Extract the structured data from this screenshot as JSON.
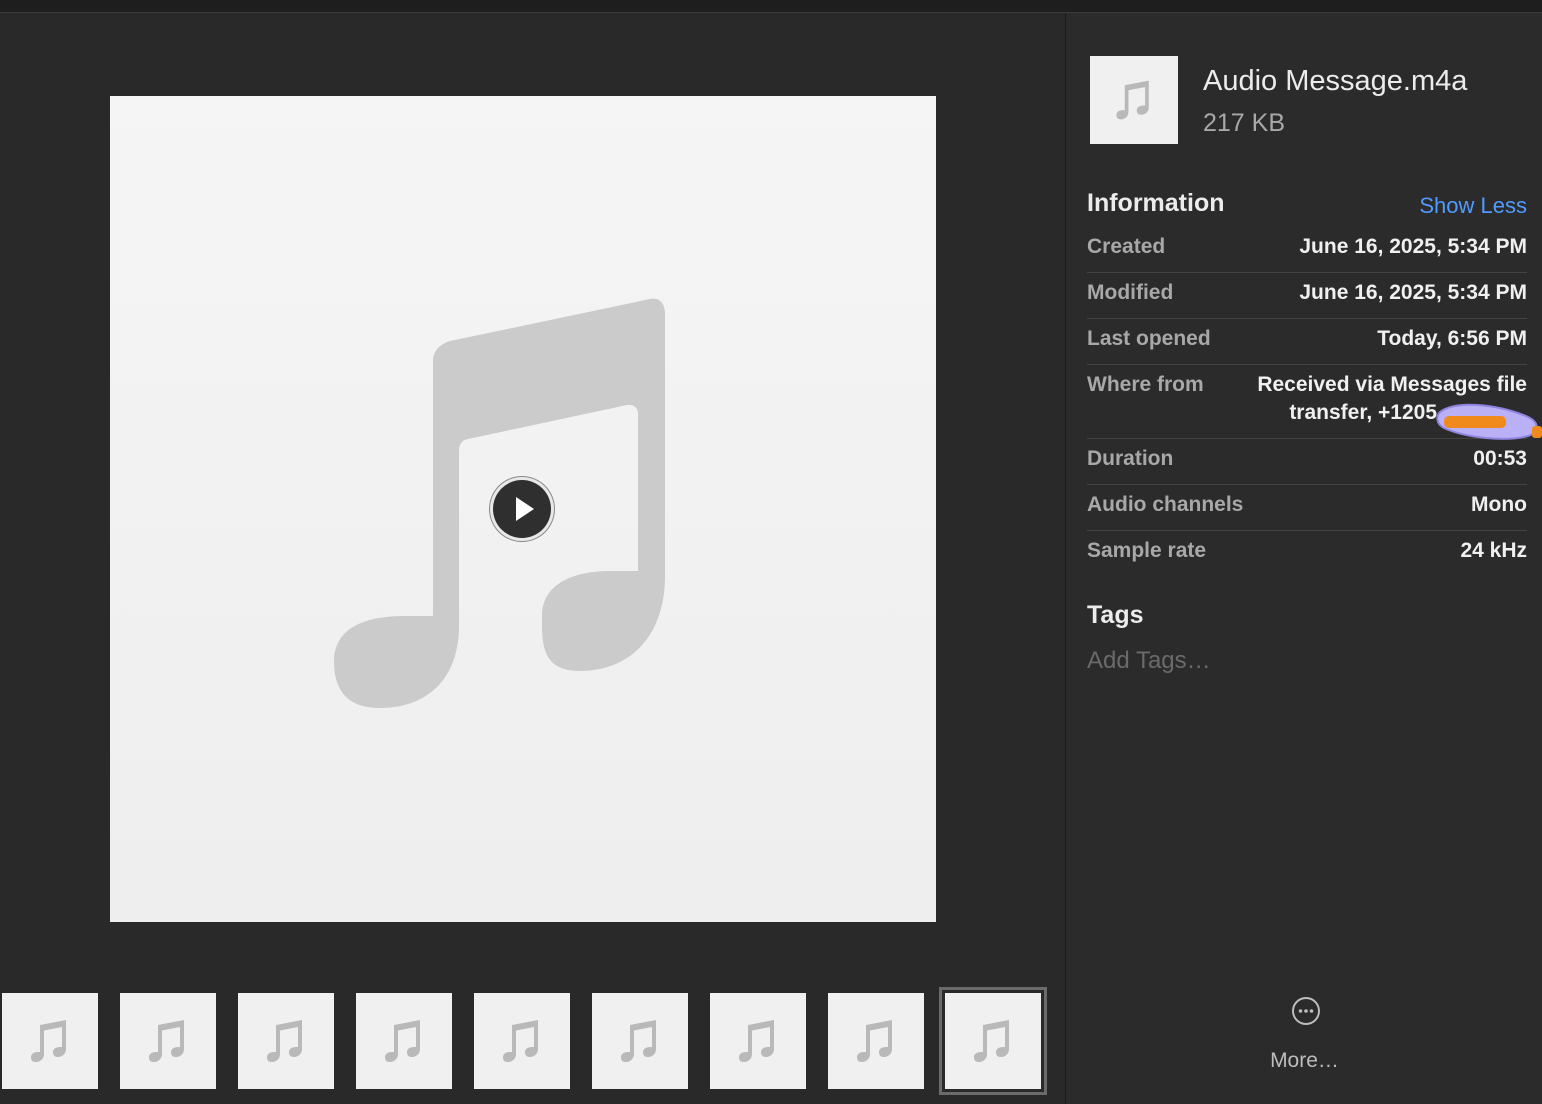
{
  "file": {
    "name": "Audio Message.m4a",
    "size": "217 KB"
  },
  "information": {
    "title": "Information",
    "toggle_label": "Show Less",
    "rows": [
      {
        "label": "Created",
        "value": "June 16, 2025, 5:34 PM"
      },
      {
        "label": "Modified",
        "value": "June 16, 2025, 5:34 PM"
      },
      {
        "label": "Last opened",
        "value": "Today, 6:56 PM"
      },
      {
        "label": "Where from",
        "value_line1": "Received via Messages file",
        "value_line2": "transfer, +1205"
      },
      {
        "label": "Duration",
        "value": "00:53"
      },
      {
        "label": "Audio channels",
        "value": "Mono"
      },
      {
        "label": "Sample rate",
        "value": "24 kHz"
      }
    ]
  },
  "tags": {
    "title": "Tags",
    "placeholder": "Add Tags…"
  },
  "more": {
    "label": "More…",
    "icon": "ellipsis-circle-icon"
  },
  "preview": {
    "artwork_icon": "music-note-icon",
    "play_icon": "play-icon"
  },
  "thumbnails": {
    "count": 9,
    "selected_index": 8,
    "icon": "music-note-icon"
  },
  "colors": {
    "accent": "#4f9bff",
    "background": "#2a2a2a",
    "artwork_bg": "#f2f2f2",
    "note": "#cbcbcb"
  }
}
